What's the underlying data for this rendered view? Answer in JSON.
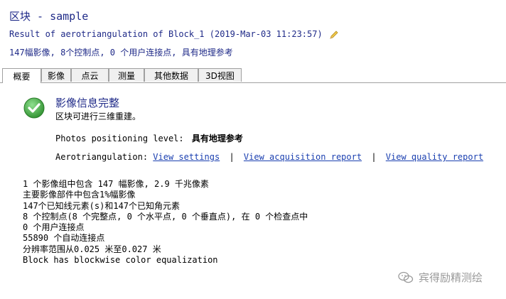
{
  "header": {
    "title": "区块 - sample",
    "subtitle": "Result of aerotriangulation of Block_1 (2019-Mar-03 11:23:57)",
    "summary": "147幅影像, 8个控制点, 0 个用户连接点, 具有地理参考"
  },
  "tabs": [
    {
      "label": "概要",
      "active": true
    },
    {
      "label": "影像",
      "active": false
    },
    {
      "label": "点云",
      "active": false
    },
    {
      "label": "测量",
      "active": false
    },
    {
      "label": "其他数据",
      "active": false
    },
    {
      "label": "3D视图",
      "active": false
    }
  ],
  "status": {
    "heading": "影像信息完整",
    "sub": "区块可进行三维重建。",
    "icon": "check-circle-icon",
    "color": "#3aa63a"
  },
  "positioning": {
    "label": "Photos positioning level:",
    "value": "具有地理参考"
  },
  "aerotriangulation": {
    "label": "Aerotriangulation:",
    "links": [
      "View settings",
      "View acquisition report",
      "View quality report"
    ],
    "separator": "|"
  },
  "stats": [
    "1 个影像组中包含 147 幅影像, 2.9 千兆像素",
    "主要影像部件中包含1%幅影像",
    "147个已知线元素(s)和147个已知角元素",
    "8 个控制点(8 个完整点, 0 个水平点, 0 个垂直点), 在 0 个检查点中",
    "0 个用户连接点",
    "55890 个自动连接点",
    "分辨率范围从0.025 米至0.027 米",
    "Block has blockwise color equalization"
  ],
  "watermark": "宾得励精测绘"
}
